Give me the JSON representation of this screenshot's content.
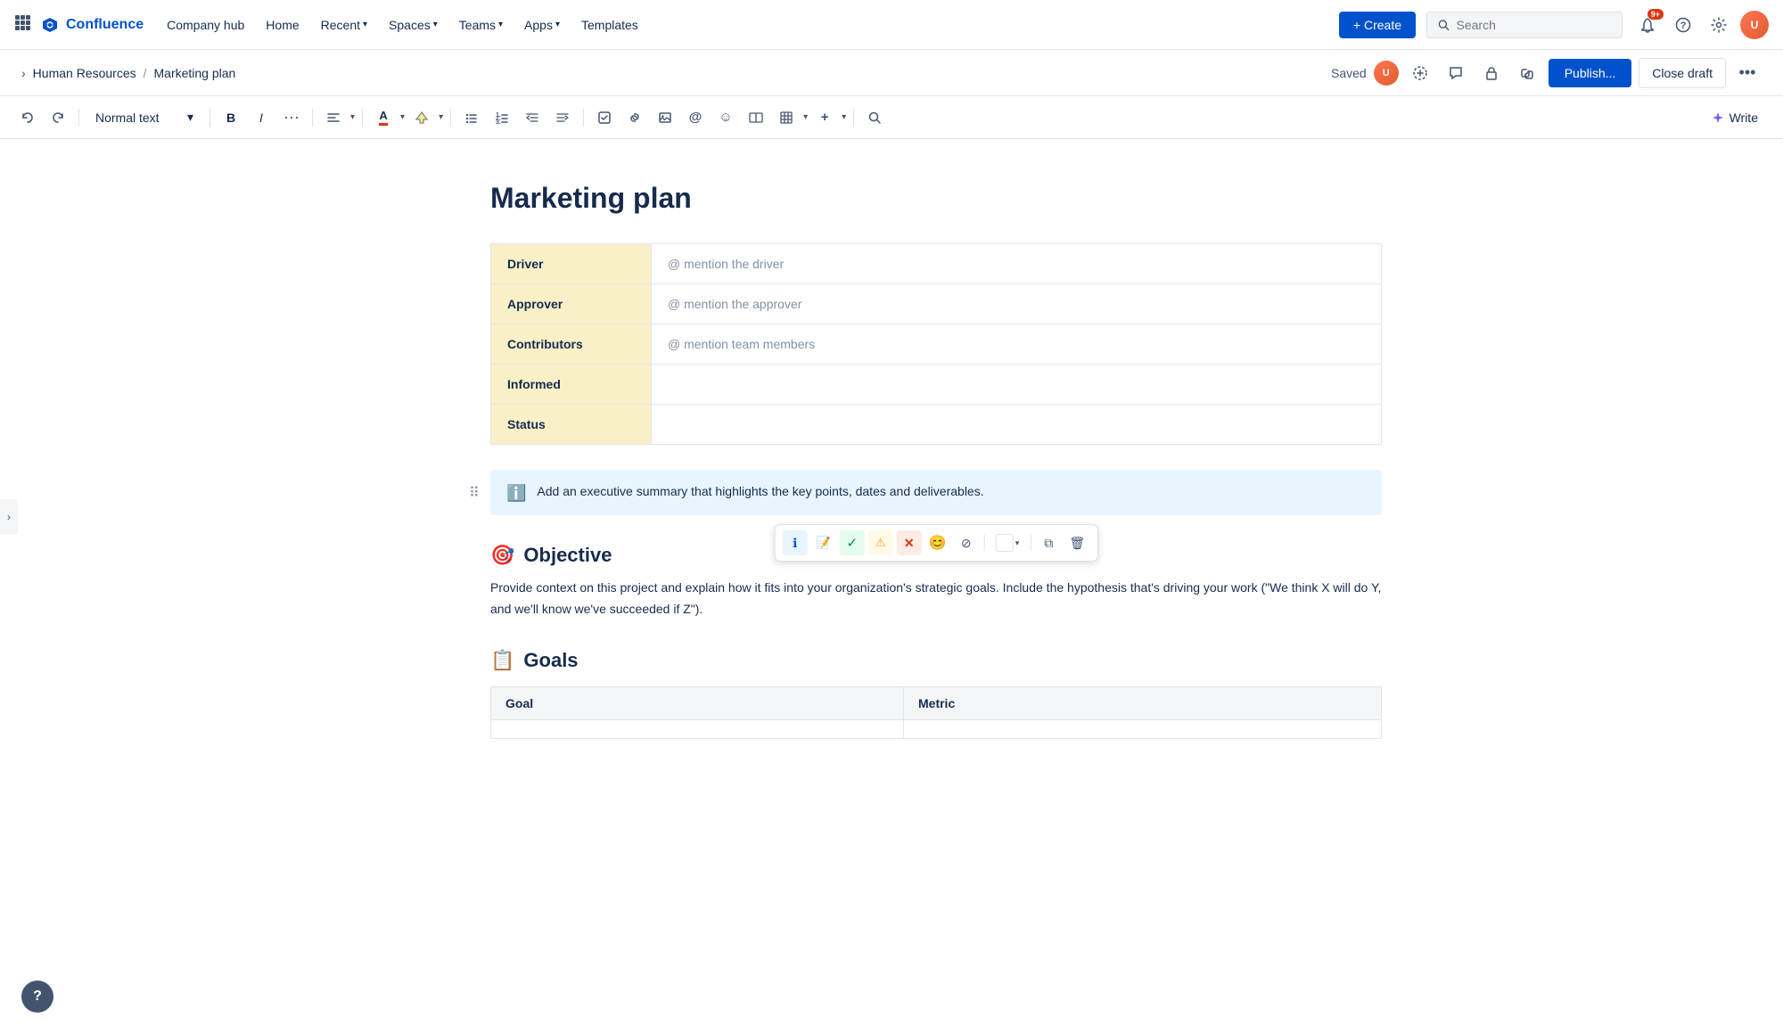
{
  "app": {
    "name": "Confluence",
    "logo_icon": "⬡"
  },
  "nav": {
    "grid_icon": "⊞",
    "items": [
      {
        "label": "Company hub",
        "has_dropdown": false
      },
      {
        "label": "Home",
        "has_dropdown": false
      },
      {
        "label": "Recent",
        "has_dropdown": true
      },
      {
        "label": "Spaces",
        "has_dropdown": true
      },
      {
        "label": "Teams",
        "has_dropdown": true
      },
      {
        "label": "Apps",
        "has_dropdown": true
      },
      {
        "label": "Templates",
        "has_dropdown": false
      }
    ],
    "create_label": "+ Create",
    "search_placeholder": "Search",
    "notification_count": "9+",
    "help_icon": "?",
    "settings_icon": "⚙"
  },
  "breadcrumb": {
    "back_arrow": "›",
    "path": [
      {
        "label": "Human Resources"
      },
      {
        "label": "Marketing plan"
      }
    ],
    "separator": "/"
  },
  "breadcrumb_actions": {
    "saved_label": "Saved",
    "publish_label": "Publish...",
    "close_draft_label": "Close draft",
    "more_icon": "•••"
  },
  "toolbar": {
    "undo_icon": "↩",
    "redo_icon": "↪",
    "text_style_label": "Normal text",
    "bold_icon": "B",
    "italic_icon": "I",
    "more_icon": "•••",
    "align_icon": "≡",
    "font_color_icon": "A",
    "bg_color_icon": "▲",
    "bullet_icon": "☰",
    "number_icon": "#",
    "outdent_icon": "⇐",
    "indent_icon": "⇒",
    "task_icon": "☑",
    "link_icon": "🔗",
    "image_icon": "🖼",
    "mention_icon": "@",
    "emoji_icon": "☺",
    "layout_icon": "⊞",
    "table_icon": "⊟",
    "insert_icon": "+",
    "search_icon": "🔍",
    "write_label": "Write",
    "write_icon": "✦"
  },
  "page": {
    "title": "Marketing plan"
  },
  "daci_table": {
    "rows": [
      {
        "label": "Driver",
        "value": "@ mention the driver",
        "is_placeholder": true
      },
      {
        "label": "Approver",
        "value": "@ mention the approver",
        "is_placeholder": true
      },
      {
        "label": "Contributors",
        "value": "@ mention team members",
        "is_placeholder": true
      },
      {
        "label": "Informed",
        "value": "",
        "is_placeholder": false
      },
      {
        "label": "Status",
        "value": "",
        "is_placeholder": false
      }
    ]
  },
  "info_panel": {
    "icon": "ℹ",
    "text": "Add an executive summary that highlights the key points, dates and deliverables."
  },
  "inline_toolbar": {
    "info_icon": "ℹ",
    "note_icon": "📝",
    "success_icon": "✓",
    "warning_icon": "⚠",
    "error_icon": "✕",
    "emoji_icon": "😊",
    "no_icon": "⊘",
    "copy_icon": "⧉",
    "delete_icon": "🗑"
  },
  "objective_section": {
    "icon": "🎯",
    "heading": "Objective",
    "text": "Provide context on this project and explain how it fits into your organization's strategic goals. Include the hypothesis that's driving your work (\"We think X will do Y, and we'll know we've succeeded if Z\")."
  },
  "goals_section": {
    "icon": "📋",
    "heading": "Goals",
    "table": {
      "columns": [
        "Goal",
        "Metric"
      ]
    }
  },
  "help_button_label": "?"
}
